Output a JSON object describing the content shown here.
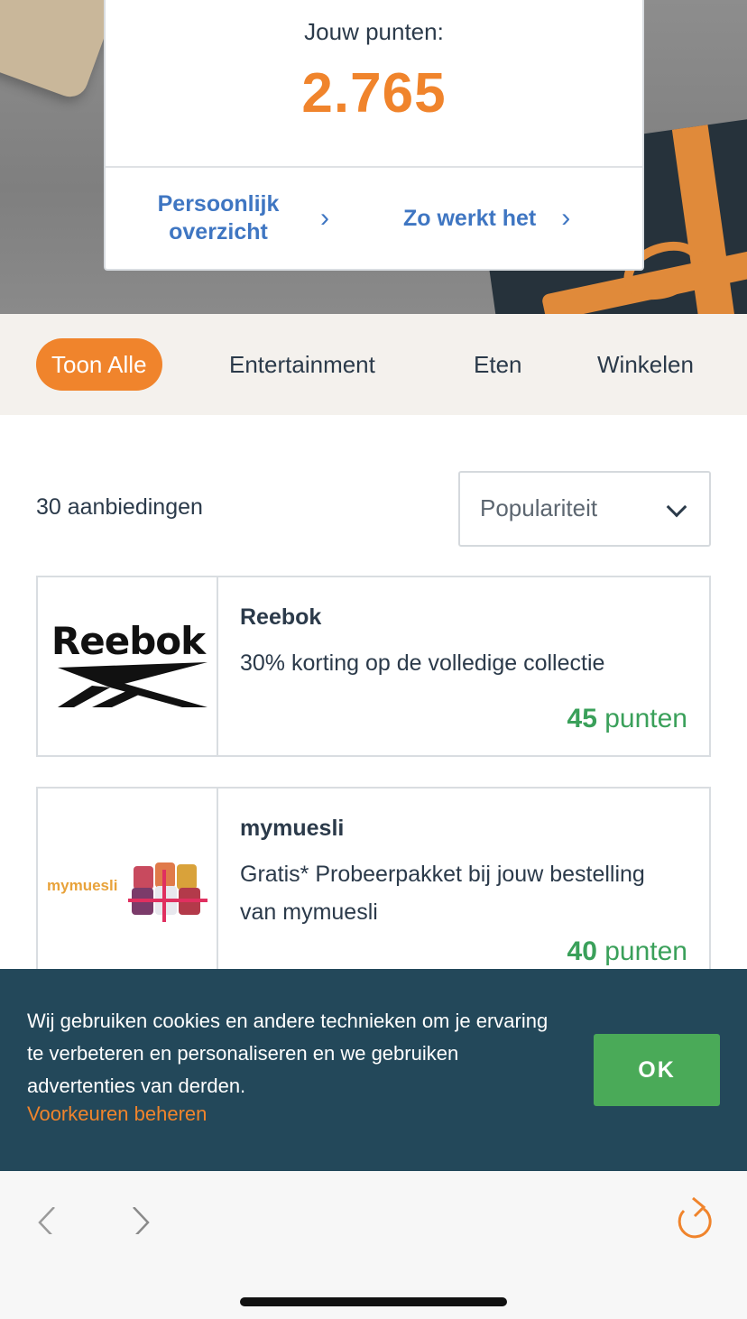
{
  "points": {
    "label": "Jouw punten:",
    "value": "2.765",
    "links": [
      {
        "label": "Persoonlijk overzicht"
      },
      {
        "label": "Zo werkt het"
      }
    ]
  },
  "tabs": [
    {
      "label": "Toon Alle",
      "active": true
    },
    {
      "label": "Entertainment"
    },
    {
      "label": "Eten"
    },
    {
      "label": "Winkelen"
    }
  ],
  "listing": {
    "count_label": "30 aanbiedingen",
    "sort_value": "Populariteit"
  },
  "offers": [
    {
      "brand": "Reebok",
      "logo_text": "Reebok",
      "description": "30% korting op de volledige collectie",
      "points": "45",
      "points_unit": "punten"
    },
    {
      "brand": "mymuesli",
      "logo_text_a": "my",
      "logo_text_b": "muesli",
      "description": "Gratis* Probeerpakket bij jouw bestelling van mymuesli",
      "points": "40",
      "points_unit": "punten"
    }
  ],
  "cookie": {
    "text": "Wij gebruiken cookies en andere technieken om je ervaring te verbeteren en personaliseren en we gebruiken advertenties van derden.",
    "manage_link": "Voorkeuren beheren",
    "ok_label": "OK"
  },
  "colors": {
    "accent": "#f0842c",
    "link": "#3f76c2",
    "points_green": "#3aa05a",
    "banner": "#23485a",
    "ok_button": "#4aaa58"
  },
  "icons": {
    "back": "chevron-left-icon",
    "forward": "chevron-right-icon",
    "reload": "reload-icon"
  }
}
